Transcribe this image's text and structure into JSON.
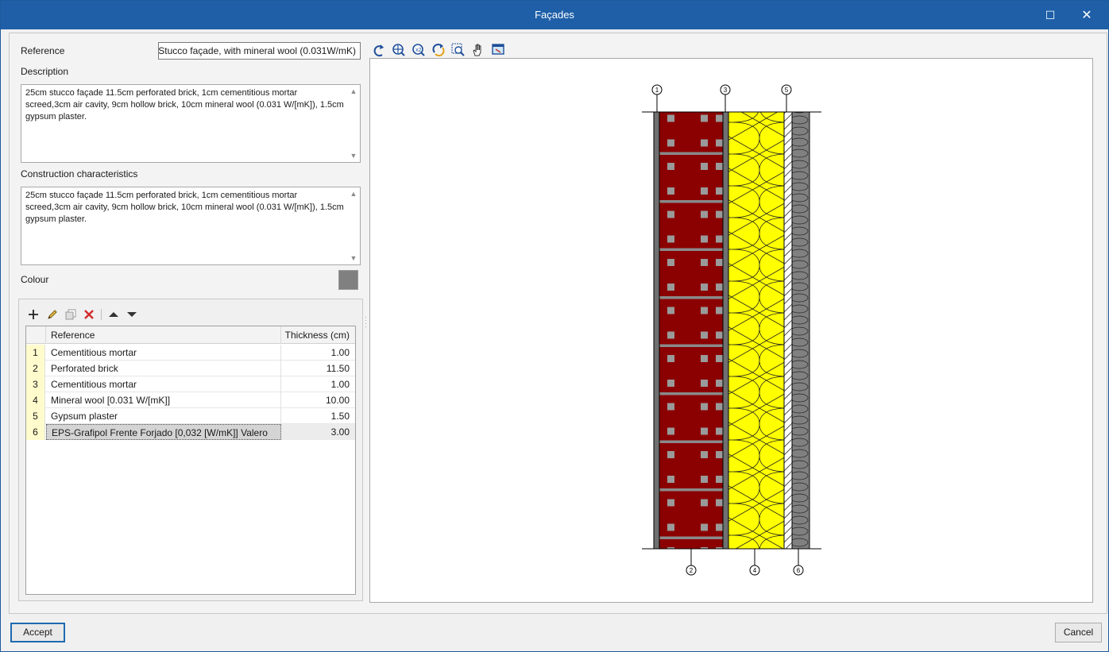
{
  "window": {
    "title": "Façades",
    "maximize_glyph": "☐",
    "close_glyph": "✕"
  },
  "form": {
    "reference_label": "Reference",
    "reference_value": "Stucco façade, with mineral wool (0.031W/mK)",
    "description_label": "Description",
    "description_value": "25cm stucco façade 11.5cm perforated brick, 1cm cementitious mortar screed,3cm air cavity, 9cm hollow brick, 10cm mineral wool (0.031 W/[mK]), 1.5cm gypsum plaster.",
    "construction_label": "Construction characteristics",
    "construction_value": "25cm stucco façade 11.5cm perforated brick, 1cm cementitious mortar screed,3cm air cavity, 9cm hollow brick, 10cm mineral wool (0.031 W/[mK]), 1.5cm gypsum plaster.",
    "colour_label": "Colour",
    "colour_value": "#808080"
  },
  "layers_toolbar": {
    "icons": [
      "add-icon",
      "edit-icon",
      "copy-icon",
      "delete-icon",
      "move-up-icon",
      "move-down-icon"
    ]
  },
  "layers_table": {
    "columns": [
      "Reference",
      "Thickness (cm)"
    ],
    "rows": [
      {
        "n": "1",
        "reference": "Cementitious mortar",
        "thickness": "1.00"
      },
      {
        "n": "2",
        "reference": "Perforated brick",
        "thickness": "11.50"
      },
      {
        "n": "3",
        "reference": "Cementitious mortar",
        "thickness": "1.00"
      },
      {
        "n": "4",
        "reference": "Mineral wool  [0.031 W/[mK]]",
        "thickness": "10.00"
      },
      {
        "n": "5",
        "reference": "Gypsum plaster",
        "thickness": "1.50"
      },
      {
        "n": "6",
        "reference": "EPS-Grafipol Frente Forjado [0,032 [W/mK]] Valero",
        "thickness": "3.00"
      }
    ],
    "selected_row": 6
  },
  "view_toolbar": {
    "icons": [
      "undo-view-icon",
      "zoom-extents-icon",
      "zoom-x2-icon",
      "redraw-icon",
      "zoom-out-icon",
      "pan-icon",
      "export-view-icon"
    ]
  },
  "drawing": {
    "top_callouts": [
      "1",
      "3",
      "5"
    ],
    "bottom_callouts": [
      "2",
      "4",
      "6"
    ],
    "brick_color": "#8b0000",
    "insulation_color": "#ffff00",
    "plaster_color": "#808080"
  },
  "footer": {
    "accept_label": "Accept",
    "cancel_label": "Cancel"
  }
}
